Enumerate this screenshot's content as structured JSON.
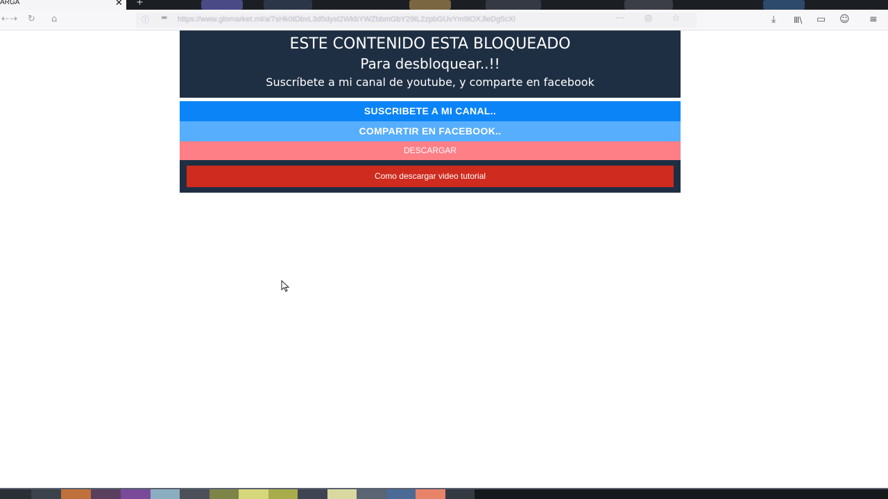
{
  "browser": {
    "tab_title": "ARGA",
    "tab_close": "✕",
    "new_tab": "+",
    "url": "https://www.glomarket.ml/a/7sHk0tDbvL3d5dyst2WkbYWZbbmGbY29tL2zpbGUvYm9lOXJleDg5cXl",
    "nav_back": "⇠",
    "nav_forward": "⇢",
    "nav_reload": "↻",
    "nav_home": "⌂",
    "url_info": "ⓘ",
    "url_lock": "▬",
    "url_actions": "⋯ ◎ ☆",
    "toolbar": {
      "download": "⤓",
      "library": "Ⅲ\\",
      "sidebar": "▭",
      "account": "☺",
      "menu": "≡"
    }
  },
  "locker": {
    "title": "ESTE CONTENIDO ESTA BLOQUEADO",
    "subtitle": "Para desbloquear..!!",
    "instruction": "Suscríbete a mi canal de youtube, y comparte en facebook",
    "subscribe_label": "SUSCRIBETE A MI CANAL..",
    "share_label": "COMPARTIR EN FACEBOOK..",
    "download_label": "DESCARGAR",
    "tutorial_label": "Como descargar video tutorial"
  },
  "colors": {
    "header_bg": "#1f2f43",
    "subscribe": "#0a84f7",
    "share": "#57aefc",
    "download": "#ff7f86",
    "tutorial": "#cf2b1e"
  }
}
